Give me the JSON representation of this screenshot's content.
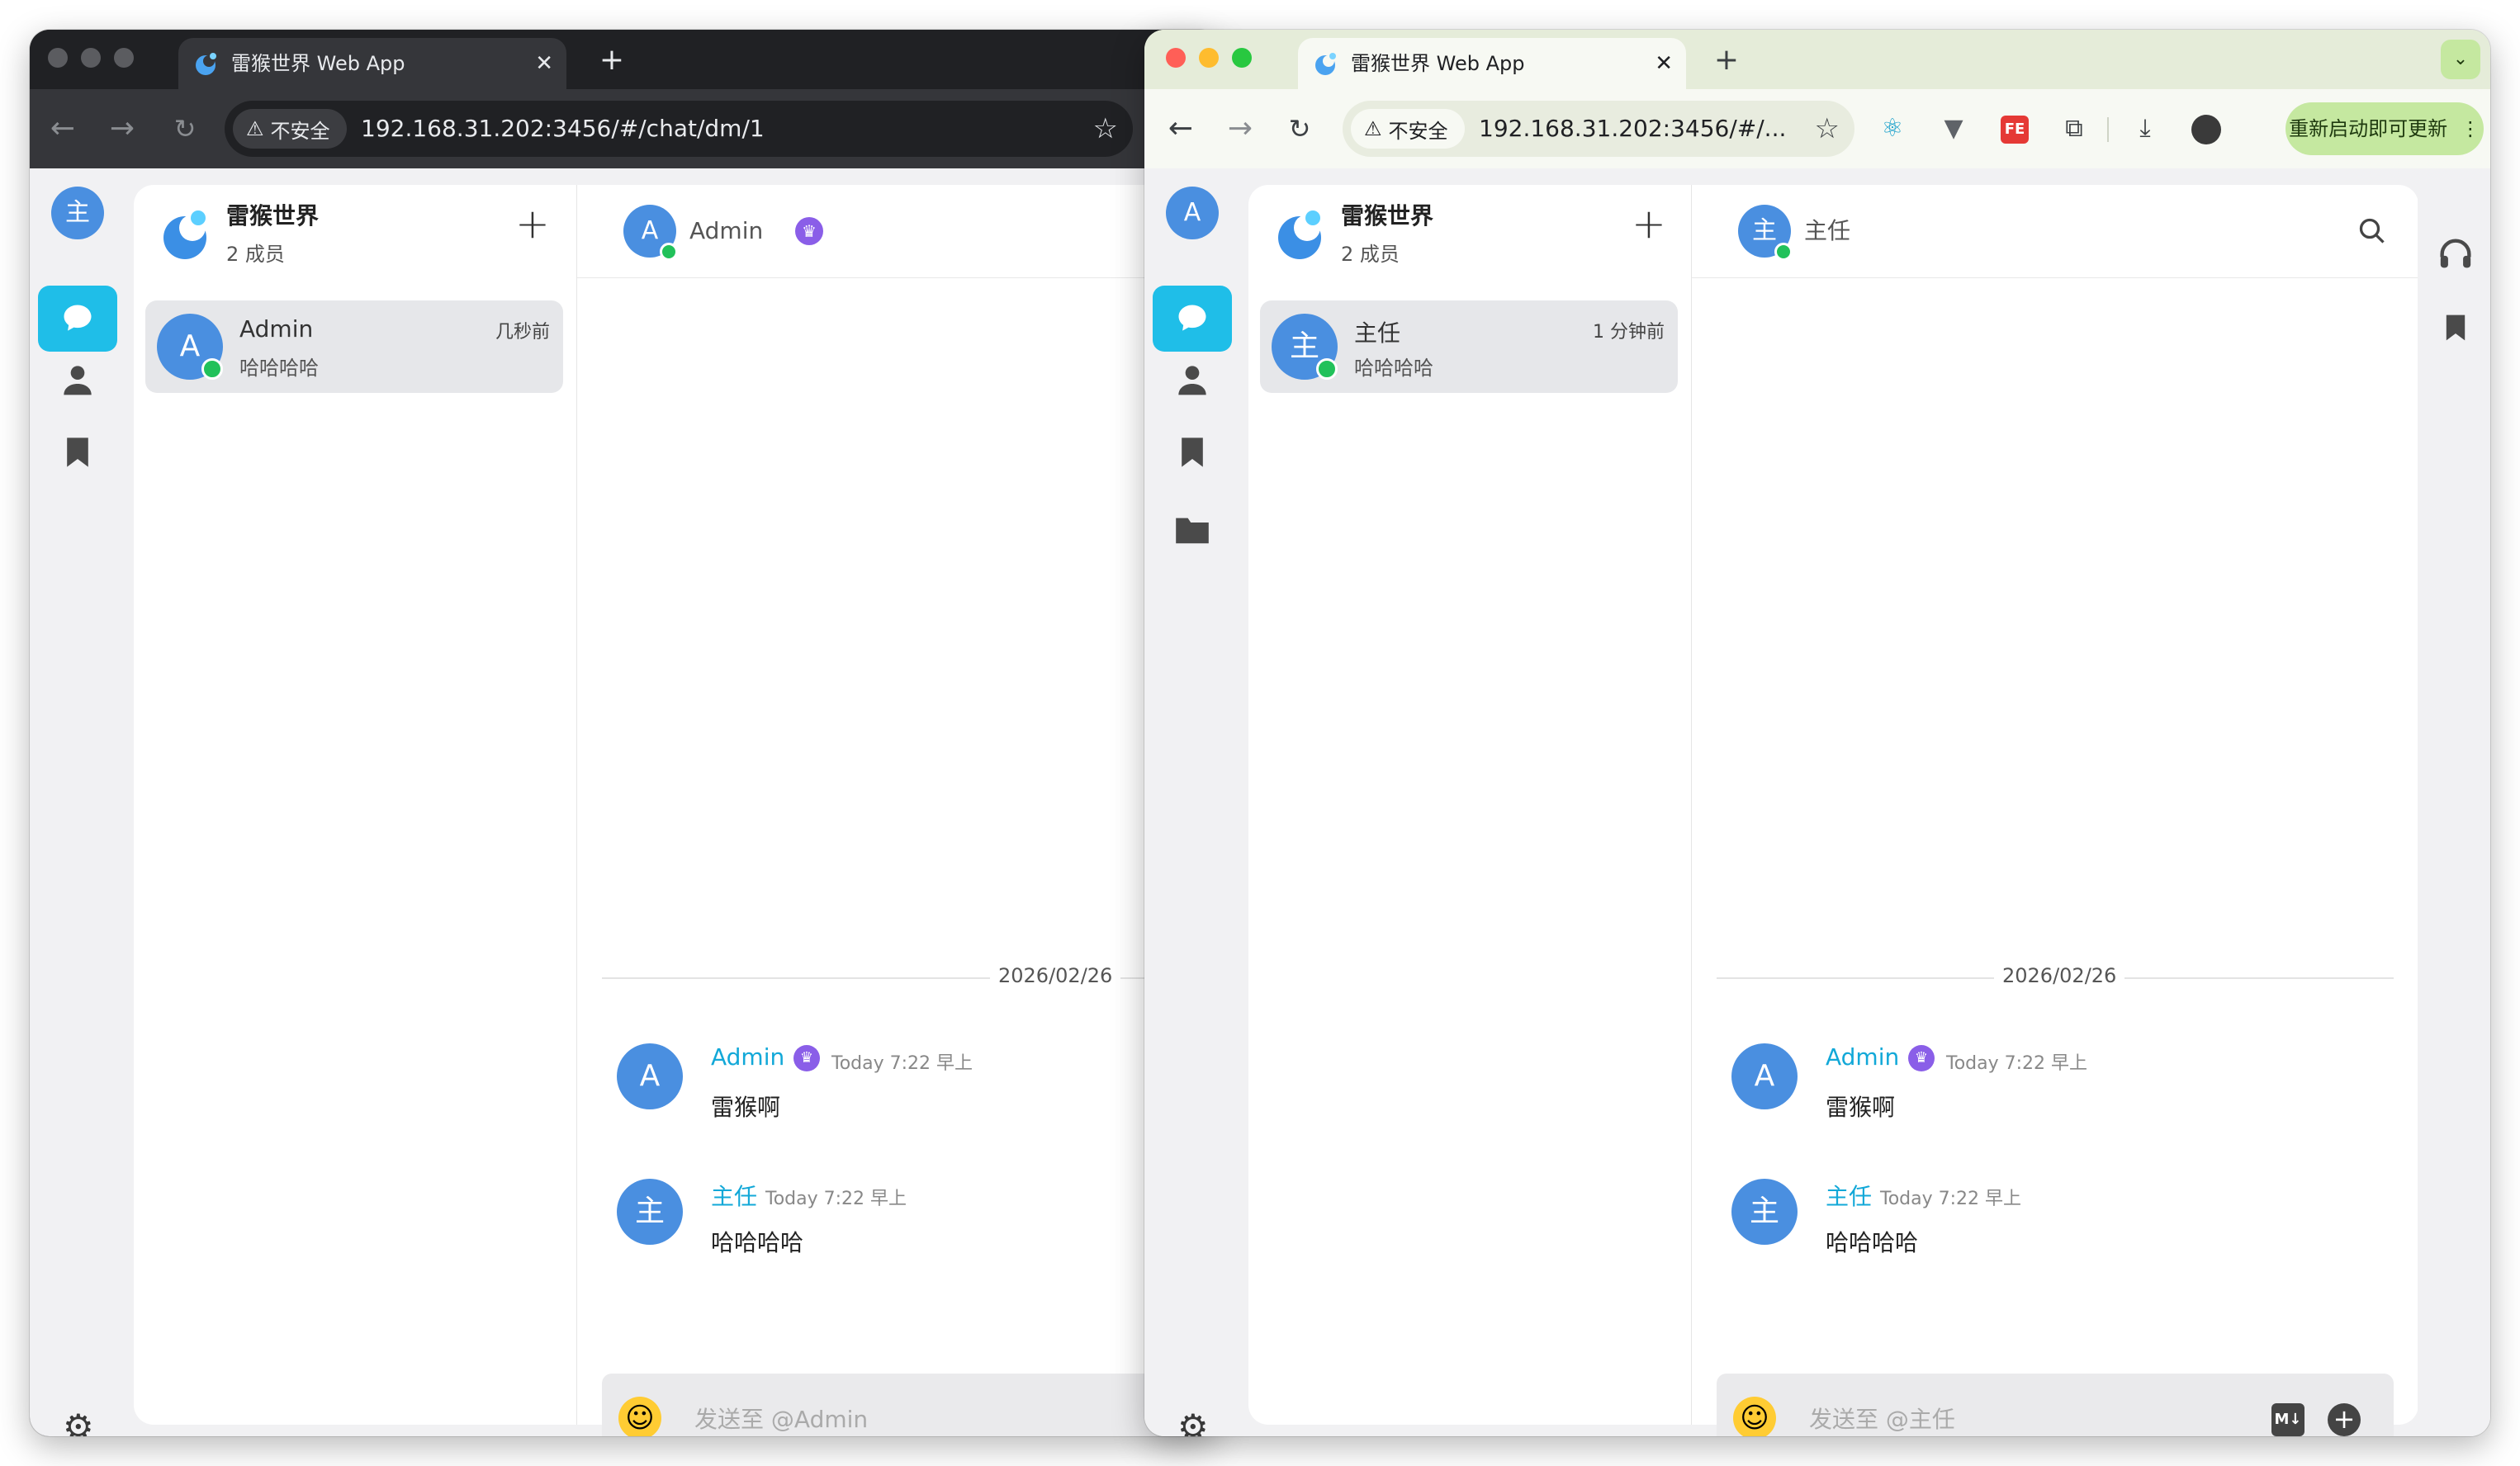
{
  "app": {
    "tab_title": "雷猴世界 Web App",
    "tab_close": "✕",
    "new_tab": "+",
    "insecure_label": "不安全",
    "server_name": "雷猴世界",
    "member_count": "2 成员",
    "add_label": "+",
    "date_divider": "2026/02/26"
  },
  "left_window": {
    "url": "192.168.31.202:3456/#/chat/dm/1",
    "self_avatar": "主",
    "dm": {
      "avatar": "A",
      "name": "Admin",
      "last_message": "哈哈哈哈",
      "time": "几秒前"
    },
    "header": {
      "avatar": "A",
      "name": "Admin"
    },
    "composer_placeholder": "发送至 @Admin"
  },
  "right_window": {
    "url": "192.168.31.202:3456/#/...",
    "self_avatar": "A",
    "dm": {
      "avatar": "主",
      "name": "主任",
      "last_message": "哈哈哈哈",
      "time": "1 分钟前"
    },
    "header": {
      "avatar": "主",
      "name": "主任"
    },
    "composer_placeholder": "发送至 @主任",
    "update_button": "重新启动即可更新"
  },
  "messages": [
    {
      "avatar": "A",
      "name": "Admin",
      "time": "Today 7:22 早上",
      "text": "雷猴啊",
      "crown": true
    },
    {
      "avatar": "主",
      "name": "主任",
      "time": "Today 7:22 早上",
      "text": "哈哈哈哈",
      "crown": false
    }
  ],
  "icons": {
    "nav": [
      "chat-icon",
      "person-icon",
      "bookmark-icon",
      "folder-icon"
    ],
    "settings": "gear-icon",
    "header_search": "search-icon",
    "rail": [
      "headset-icon",
      "bookmark-icon"
    ]
  },
  "colors": {
    "accent": "#1fbee8",
    "avatar": "#4a8fe0",
    "online": "#21c15a",
    "crown": "#8a5ee8",
    "update": "#c5e8a0"
  }
}
